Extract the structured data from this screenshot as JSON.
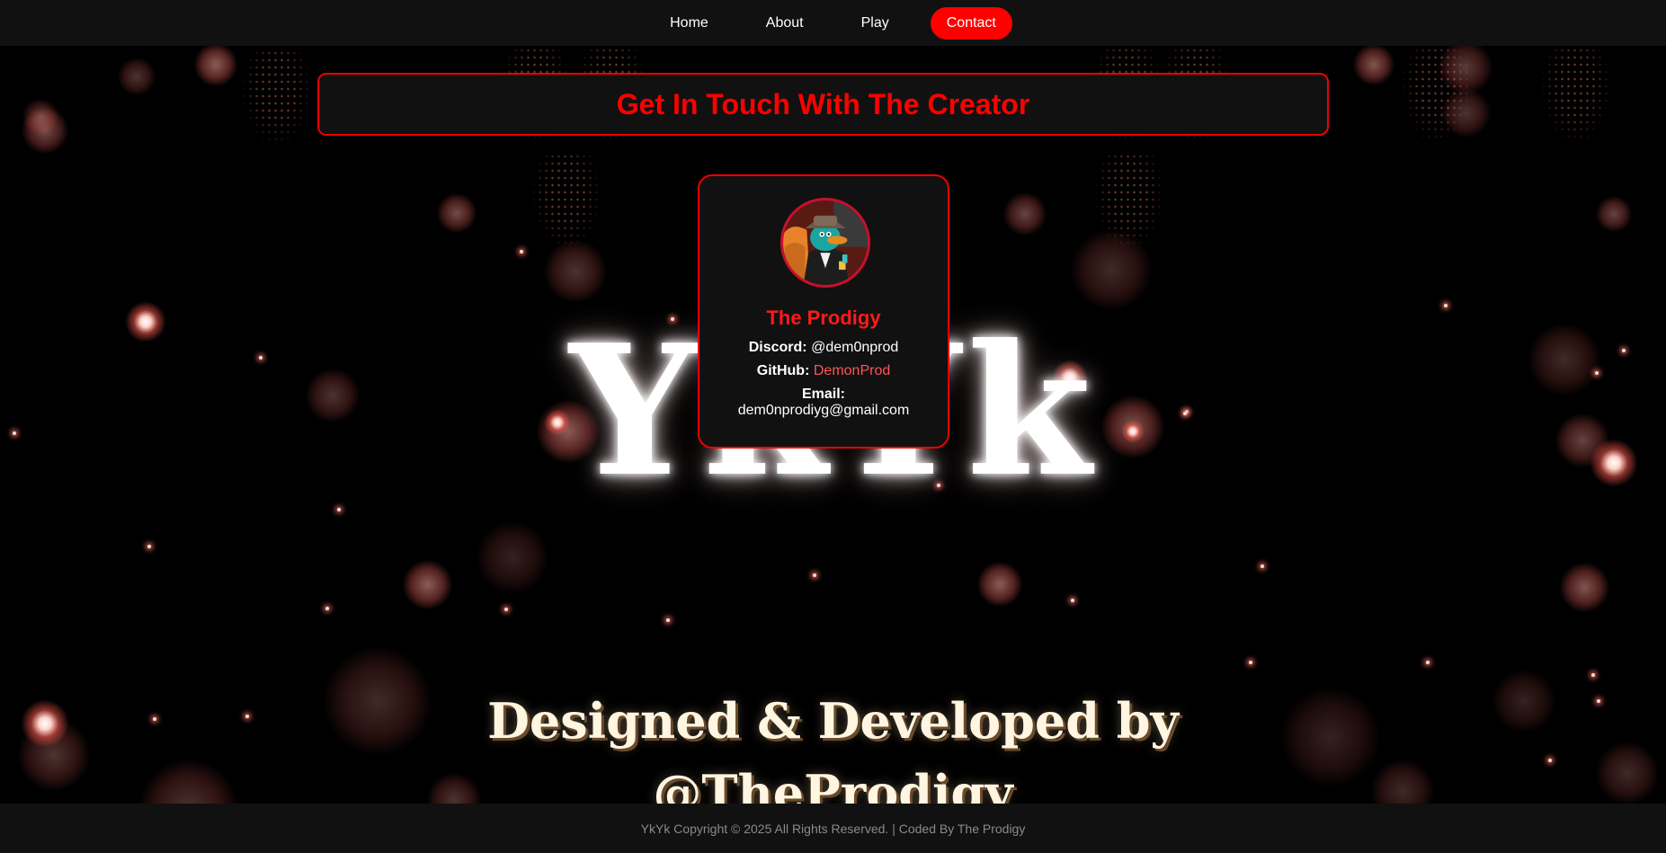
{
  "nav": {
    "items": [
      {
        "label": "Home",
        "active": false
      },
      {
        "label": "About",
        "active": false
      },
      {
        "label": "Play",
        "active": false
      },
      {
        "label": "Contact",
        "active": true
      }
    ]
  },
  "banner": {
    "title": "Get In Touch With The Creator"
  },
  "background": {
    "logo_text": "YkYk"
  },
  "card": {
    "name": "The Prodigy",
    "discord_label": "Discord:",
    "discord_value": "@dem0nprod",
    "github_label": "GitHub:",
    "github_value": "DemonProd",
    "email_label": "Email:",
    "email_value": "dem0nprodiyg@gmail.com",
    "avatar_icon": "perry-the-platypus-avatar-icon"
  },
  "credit": {
    "line1": "Designed & Developed by",
    "line2": "@TheProdigy"
  },
  "footer": {
    "text": "YkYk Copyright © 2025 All Rights Reserved. | Coded By The Prodigy"
  },
  "colors": {
    "accent": "#ff0000",
    "panel": "#111111",
    "background": "#000000",
    "link": "#ff5555",
    "footer_text": "#8a8a8a"
  }
}
